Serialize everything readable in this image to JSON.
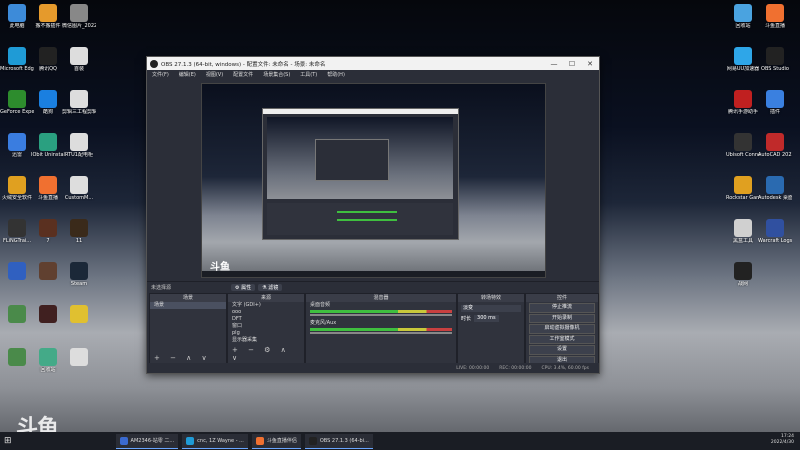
{
  "desktop_left": [
    {
      "label": "此电脑",
      "icon": "computer-icon",
      "color": "#3d8bd9"
    },
    {
      "label": "搬不搬插件",
      "icon": "app-icon",
      "color": "#e59a2c"
    },
    {
      "label": "微信图片_2022031...",
      "icon": "image-file-icon",
      "color": "#888"
    },
    {
      "label": "Microsoft Edge",
      "icon": "edge-icon",
      "color": "#1f9bd6"
    },
    {
      "label": "腾讯QQ",
      "icon": "qq-icon",
      "color": "#222"
    },
    {
      "label": "首装",
      "icon": "document-icon",
      "color": "#ddd"
    },
    {
      "label": "GeForce Experience",
      "icon": "nvidia-icon",
      "color": "#2d8c2d"
    },
    {
      "label": "酷狗",
      "icon": "kugou-icon",
      "color": "#1a7fe0"
    },
    {
      "label": "剪辑三工程剪辑设置20...",
      "icon": "document-icon",
      "color": "#ddd"
    },
    {
      "label": "迅雷",
      "icon": "xunlei-icon",
      "color": "#3a7de0"
    },
    {
      "label": "IObit Uninstaller",
      "icon": "iobit-icon",
      "color": "#2aa080"
    },
    {
      "label": "RTU1配电柜",
      "icon": "document-icon",
      "color": "#ddd"
    },
    {
      "label": "火绒安全软件",
      "icon": "huorong-icon",
      "color": "#e0a020"
    },
    {
      "label": "斗鱼直播",
      "icon": "douyu-icon",
      "color": "#f07030"
    },
    {
      "label": "CustomM...",
      "icon": "document-icon",
      "color": "#ddd"
    },
    {
      "label": "FLiNGTrai...",
      "icon": "trainer-icon",
      "color": "#333"
    },
    {
      "label": "7",
      "icon": "game-icon",
      "color": "#5a3020"
    },
    {
      "label": "11",
      "icon": "game-icon",
      "color": "#3a2a1a"
    },
    {
      "label": "",
      "icon": "app-icon",
      "color": "#3060c0"
    },
    {
      "label": "",
      "icon": "game-icon",
      "color": "#604030"
    },
    {
      "label": "Steam",
      "icon": "steam-icon",
      "color": "#1b2838"
    },
    {
      "label": "",
      "icon": "document-icon",
      "color": "#4a8a4a"
    },
    {
      "label": "",
      "icon": "game-icon",
      "color": "#402020"
    },
    {
      "label": "",
      "icon": "app-icon",
      "color": "#e0c030"
    },
    {
      "label": "",
      "icon": "document-icon",
      "color": "#4a8a4a"
    },
    {
      "label": "回收站",
      "icon": "recycle-bin-icon",
      "color": "#4a8"
    },
    {
      "label": "",
      "icon": "document-icon",
      "color": "#ddd"
    }
  ],
  "desktop_right": [
    {
      "label": "回收站",
      "icon": "recycle-bin-icon",
      "color": "#4aa3e0"
    },
    {
      "label": "斗鱼直播",
      "icon": "douyu-icon",
      "color": "#f07030"
    },
    {
      "label": "网易UU加速器",
      "icon": "uu-icon",
      "color": "#2ea6e8"
    },
    {
      "label": "OBS Studio",
      "icon": "obs-icon",
      "color": "#222"
    },
    {
      "label": "腾讯手游助手",
      "icon": "tencent-icon",
      "color": "#c02020"
    },
    {
      "label": "插件",
      "icon": "plugin-icon",
      "color": "#3a80e0"
    },
    {
      "label": "Ubisoft Connect",
      "icon": "ubisoft-icon",
      "color": "#333"
    },
    {
      "label": "AutoCAD 2022 - 简...",
      "icon": "autocad-icon",
      "color": "#c02a2a"
    },
    {
      "label": "Rockstar Games...",
      "icon": "rockstar-icon",
      "color": "#e0a020"
    },
    {
      "label": "Autodesk 桌面应用程序",
      "icon": "autodesk-icon",
      "color": "#2a6ab0"
    },
    {
      "label": "黑盒工具",
      "icon": "heihe-icon",
      "color": "#d0d0d0"
    },
    {
      "label": "Warcraft Logs U...",
      "icon": "warcraft-icon",
      "color": "#3050a0"
    },
    {
      "label": "战网",
      "icon": "battlenet-icon",
      "color": "#222"
    }
  ],
  "window": {
    "title": "OBS 27.1.3 (64-bit, windows) - 配置文件: 未命名 - 场景: 未命名",
    "menu": [
      "文件(F)",
      "编辑(E)",
      "视图(V)",
      "配置文件",
      "场景集合(S)",
      "工具(T)",
      "帮助(H)"
    ],
    "minimize": "—",
    "maximize": "☐",
    "close": "✕"
  },
  "toolbar": {
    "no_source": "未选择源",
    "properties": "属性",
    "filters": "滤镜"
  },
  "scenes": {
    "header": "场景",
    "items": [
      "场景"
    ]
  },
  "sources": {
    "header": "来源",
    "items": [
      "文字 (GDI+)",
      "ooo",
      "DFT",
      "窗口",
      "plg",
      "显示器采集"
    ]
  },
  "mixer": {
    "header": "混音器",
    "tracks": [
      {
        "name": "桌面音频"
      },
      {
        "name": "麦克风/Aux"
      }
    ]
  },
  "transitions": {
    "header": "转场特效",
    "type": "淡变",
    "duration_label": "时长",
    "duration": "300 ms"
  },
  "controls": {
    "header": "控件",
    "buttons": [
      "停止推流",
      "开始录制",
      "启动虚拟摄像机",
      "工作室模式",
      "设置",
      "退出"
    ]
  },
  "status": {
    "live": "LIVE: 00:00:00",
    "rec": "REC: 00:00:00",
    "cpu": "CPU: 3.4%, 60.00 fps"
  },
  "taskbar": {
    "tasks": [
      {
        "label": "AM2346-站零 二...",
        "color": "#3a6ad0"
      },
      {
        "label": "cnc, 1Z Wayne - ...",
        "color": "#1f9bd6"
      },
      {
        "label": "斗鱼直播伴侣",
        "color": "#f07030"
      },
      {
        "label": "OBS 27.1.3 (64-bi...",
        "color": "#222"
      }
    ],
    "time": "17:24",
    "date": "2022/4/30"
  },
  "watermark": "斗鱼"
}
